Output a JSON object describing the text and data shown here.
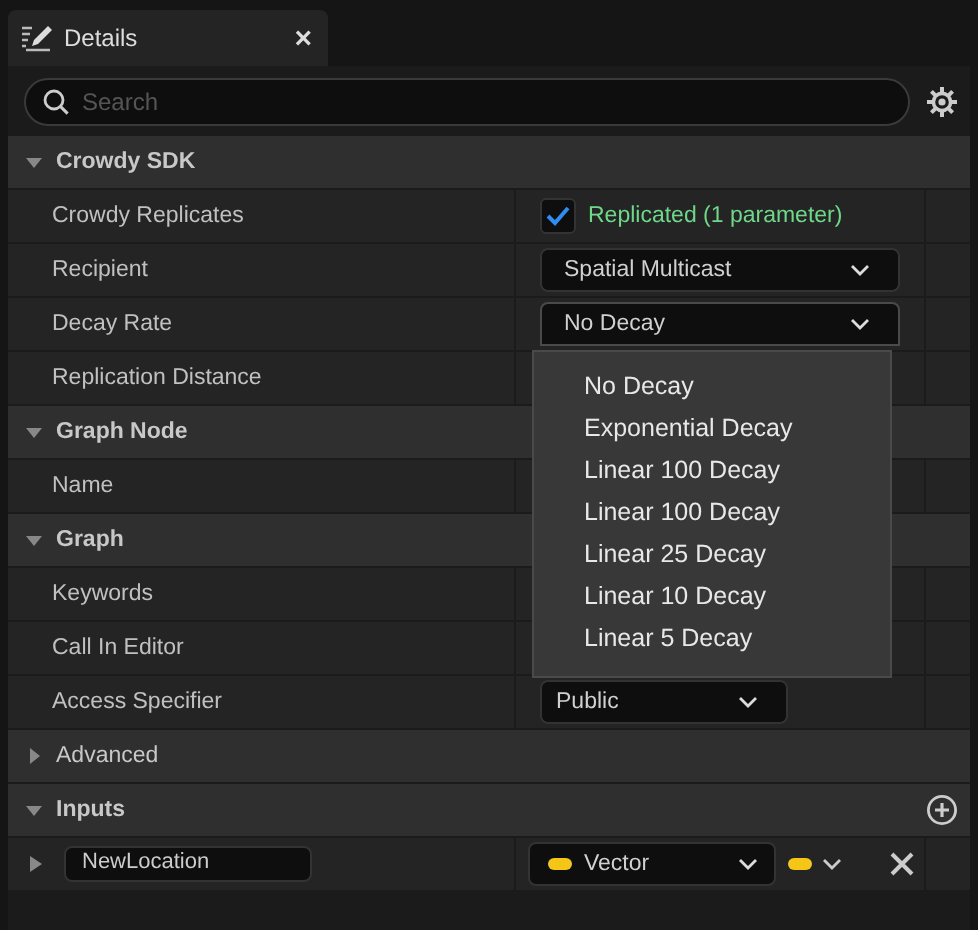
{
  "tab": {
    "title": "Details",
    "close": "×"
  },
  "search": {
    "placeholder": "Search"
  },
  "sections": [
    {
      "title": "Crowdy SDK",
      "expanded": true,
      "rows": [
        {
          "kind": "checkbox",
          "label": "Crowdy Replicates",
          "checked": true,
          "value": "Replicated (1 parameter)"
        },
        {
          "kind": "combo",
          "label": "Recipient",
          "value": "Spatial Multicast"
        },
        {
          "kind": "combo",
          "label": "Decay Rate",
          "value": "No Decay",
          "open": true
        },
        {
          "kind": "empty",
          "label": "Replication Distance"
        }
      ]
    },
    {
      "title": "Graph Node",
      "expanded": true,
      "rows": [
        {
          "kind": "empty",
          "label": "Name"
        }
      ]
    },
    {
      "title": "Graph",
      "expanded": true,
      "rows": [
        {
          "kind": "empty",
          "label": "Keywords"
        },
        {
          "kind": "empty",
          "label": "Call In Editor"
        },
        {
          "kind": "small-combo",
          "label": "Access Specifier",
          "value": "Public"
        }
      ]
    },
    {
      "title": "Advanced",
      "expanded": false
    },
    {
      "title": "Inputs",
      "expanded": true,
      "add": true,
      "rows": [
        {
          "kind": "param",
          "name": "NewLocation",
          "type": "Vector",
          "color": "#f5c518"
        }
      ]
    }
  ],
  "menu": {
    "options": [
      "No Decay",
      "Exponential Decay",
      "Linear 100 Decay",
      "Linear 100 Decay",
      "Linear 25 Decay",
      "Linear 10 Decay",
      "Linear 5 Decay"
    ]
  }
}
